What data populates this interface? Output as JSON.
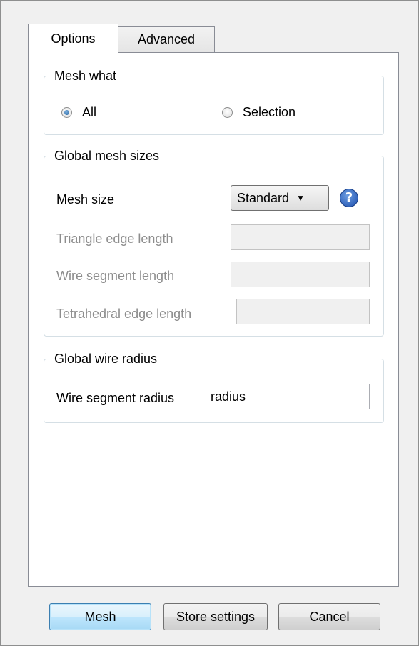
{
  "tabs": [
    {
      "label": "Options",
      "selected": true
    },
    {
      "label": "Advanced",
      "selected": false
    }
  ],
  "mesh_what": {
    "legend": "Mesh what",
    "options": [
      {
        "label": "All",
        "checked": true
      },
      {
        "label": "Selection",
        "checked": false
      }
    ]
  },
  "global_mesh_sizes": {
    "legend": "Global mesh sizes",
    "mesh_size_label": "Mesh size",
    "mesh_size_value": "Standard",
    "help_glyph": "?",
    "triangle_edge_label": "Triangle edge length",
    "triangle_edge_value": "",
    "wire_segment_label": "Wire segment length",
    "wire_segment_value": "",
    "tetrahedral_edge_label": "Tetrahedral edge length",
    "tetrahedral_edge_value": ""
  },
  "global_wire_radius": {
    "legend": "Global wire radius",
    "wire_radius_label": "Wire segment radius",
    "wire_radius_value": "radius"
  },
  "buttons": {
    "mesh": "Mesh",
    "store": "Store settings",
    "cancel": "Cancel"
  },
  "icons": {
    "help": "help-question-icon",
    "dropdown": "chevron-down-icon"
  },
  "colors": {
    "accent": "#3c7fb1",
    "help_icon": "#1d4fae",
    "disabled_text": "#8d8d8d"
  }
}
